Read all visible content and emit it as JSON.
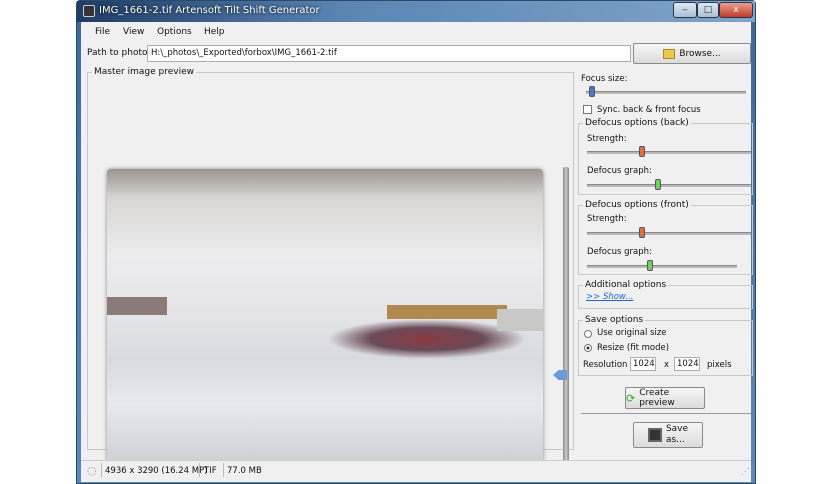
{
  "window": {
    "title": "IMG_1661-2.tif Artensoft Tilt Shift Generator",
    "minimize": "‒",
    "maximize": "□",
    "close": "x"
  },
  "menu": [
    "File",
    "View",
    "Options",
    "Help"
  ],
  "path": {
    "label": "Path to photo:",
    "value": "H:\\_photos\\_Exported\\forbox\\IMG_1661-2.tif",
    "browse": "Browse..."
  },
  "preview": {
    "label": "Master image preview",
    "focus_position": 0.7
  },
  "panel": {
    "focus_size": {
      "label": "Focus size:",
      "value": 0.05
    },
    "sync": {
      "label": "Sync. back & front focus",
      "checked": false
    },
    "back": {
      "label": "Defocus options (back)",
      "strength_label": "Strength:",
      "strength": 0.35,
      "graph_label": "Defocus graph:",
      "graph": 0.45
    },
    "front": {
      "label": "Defocus options (front)",
      "strength_label": "Strength:",
      "strength": 0.35,
      "graph_label": "Defocus graph:",
      "graph": 0.42
    },
    "additional": {
      "label": "Additional options",
      "link": ">> Show..."
    },
    "save": {
      "label": "Save options",
      "opt1": "Use original size",
      "opt2": "Resize (fit mode)",
      "res_label": "Resolution",
      "w": "1024",
      "x": "x",
      "h": "1024",
      "unit": "pixels"
    },
    "create_preview": "Create preview",
    "save_as_1": "Save",
    "save_as_2": "as..."
  },
  "status": {
    "dims": "4936 x 3290 (16.24 MP)",
    "format": "TIF",
    "size": "77.0 MB"
  }
}
